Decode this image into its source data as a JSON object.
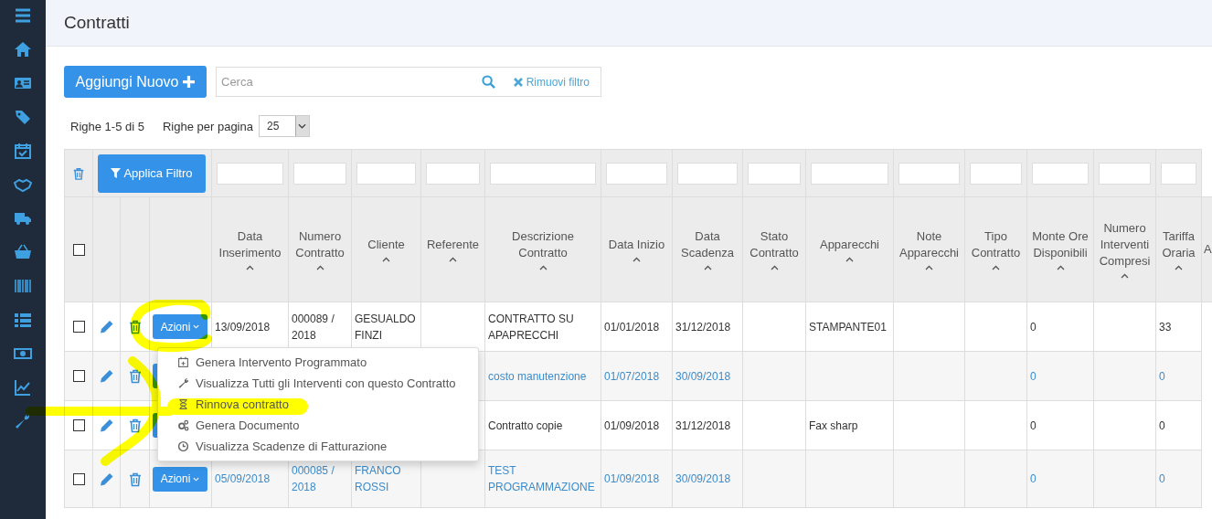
{
  "page_title": "Contratti",
  "add_button": "Aggiungi Nuovo",
  "search": {
    "placeholder": "Cerca"
  },
  "clear_filter": "Rimuovi filtro",
  "rows_info": "Righe 1-5 di 5",
  "per_page_label": "Righe per pagina",
  "per_page_value": "25",
  "apply_filter": "Applica Filtro",
  "header_checked": false,
  "columns": [
    {
      "label": "Data Inserimento",
      "sortable": true
    },
    {
      "label": "Numero Contratto",
      "sortable": true
    },
    {
      "label": "Cliente",
      "sortable": true
    },
    {
      "label": "Referente",
      "sortable": true
    },
    {
      "label": "Descrizione Contratto",
      "sortable": true
    },
    {
      "label": "Data Inizio",
      "sortable": true
    },
    {
      "label": "Data Scadenza",
      "sortable": true
    },
    {
      "label": "Stato Contratto",
      "sortable": true
    },
    {
      "label": "Apparecchi",
      "sortable": true
    },
    {
      "label": "Note Apparecchi",
      "sortable": true
    },
    {
      "label": "Tipo Contratto",
      "sortable": true
    },
    {
      "label": "Monte Ore Disponibili",
      "sortable": true
    },
    {
      "label": "Numero Interventi Compresi",
      "sortable": true
    },
    {
      "label": "Tariffa Oraria",
      "sortable": true
    }
  ],
  "last_column_header": "A",
  "rows": [
    {
      "checked": false,
      "linked": false,
      "actions": "Azioni",
      "cells": [
        "13/09/2018",
        "000089 / 2018",
        "GESUALDO FINZI",
        null,
        "CONTRATTO SU APAPRECCHI",
        "01/01/2018",
        "31/12/2018",
        null,
        "STAMPANTE01",
        null,
        null,
        "0",
        null,
        "33",
        null
      ]
    },
    {
      "checked": false,
      "linked": true,
      "cells": [
        null,
        null,
        null,
        null,
        "costo manutenzione",
        "01/07/2018",
        "30/09/2018",
        null,
        null,
        null,
        null,
        "0",
        null,
        "0",
        null
      ]
    },
    {
      "checked": false,
      "linked": false,
      "cells": [
        null,
        null,
        null,
        null,
        "Contratto copie",
        "01/09/2018",
        "31/12/2018",
        null,
        "Fax sharp",
        null,
        null,
        "0",
        null,
        "0",
        null
      ]
    },
    {
      "checked": false,
      "linked": true,
      "actions": "Azioni",
      "cells": [
        "05/09/2018",
        "000085 / 2018",
        "FRANCO ROSSI",
        null,
        "TEST PROGRAMMAZIONE",
        "01/09/2018",
        "30/09/2018",
        null,
        null,
        null,
        null,
        "0",
        null,
        "0",
        null
      ]
    }
  ],
  "menu": {
    "items": [
      {
        "label": "Genera Intervento Programmato"
      },
      {
        "label": "Visualizza Tutti gli Interventi con questo Contratto"
      },
      {
        "label": "Rinnova contratto"
      },
      {
        "label": "Genera Documento"
      },
      {
        "label": "Visualizza Scadenze di Fatturazione"
      }
    ]
  }
}
